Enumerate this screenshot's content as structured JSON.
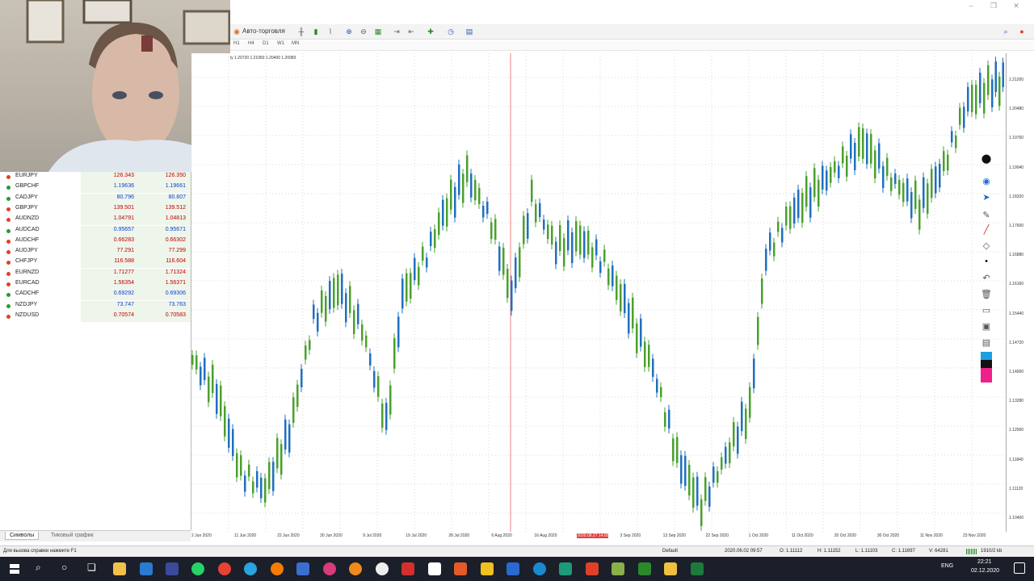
{
  "toolbar": {
    "autotrade_label": "Авто-торговля",
    "timeframes": [
      "H1",
      "H4",
      "D1",
      "W1",
      "MN"
    ]
  },
  "chart": {
    "info_line": "ly  1.20720  1.21083  1.20400  1.20983",
    "price_labels": [
      "1.21200",
      "1.20480",
      "1.19760",
      "1.19040",
      "1.18320",
      "1.17600",
      "1.16880",
      "1.16160",
      "1.15440",
      "1.14720",
      "1.14000",
      "1.13280",
      "1.12560",
      "1.11840",
      "1.11120",
      "1.10400"
    ],
    "time_labels": [
      "2 Jun 2020",
      "11 Jun 2020",
      "22 Jun 2020",
      "30 Jun 2020",
      "9 Jul 2020",
      "19 Jul 2020",
      "28 Jul 2020",
      "6 Aug 2020",
      "16 Aug 2020",
      "2020.08.27 14:00",
      "3 Sep 2020",
      "13 Sep 2020",
      "22 Sep 2020",
      "1 Oct 2020",
      "11 Oct 2020",
      "20 Oct 2020",
      "30 Oct 2020",
      "11 Nov 2020",
      "23 Nov 2020"
    ]
  },
  "watchlist": {
    "rows": [
      {
        "symbol": "EURJPY",
        "bid": "126.343",
        "ask": "126.350",
        "color": "#c00000"
      },
      {
        "symbol": "GBPCHF",
        "bid": "1.19636",
        "ask": "1.19661",
        "color": "#1040d0"
      },
      {
        "symbol": "CADJPY",
        "bid": "80.796",
        "ask": "80.807",
        "color": "#1040d0"
      },
      {
        "symbol": "GBPJPY",
        "bid": "139.501",
        "ask": "139.512",
        "color": "#c00000"
      },
      {
        "symbol": "AUDNZD",
        "bid": "1.04791",
        "ask": "1.04813",
        "color": "#c00000"
      },
      {
        "symbol": "AUDCAD",
        "bid": "0.95657",
        "ask": "0.95671",
        "color": "#1040d0"
      },
      {
        "symbol": "AUDCHF",
        "bid": "0.66283",
        "ask": "0.66302",
        "color": "#c00000"
      },
      {
        "symbol": "AUDJPY",
        "bid": "77.291",
        "ask": "77.299",
        "color": "#c00000"
      },
      {
        "symbol": "CHFJPY",
        "bid": "116.588",
        "ask": "116.604",
        "color": "#c00000"
      },
      {
        "symbol": "EURNZD",
        "bid": "1.71277",
        "ask": "1.71324",
        "color": "#c00000"
      },
      {
        "symbol": "EURCAD",
        "bid": "1.56354",
        "ask": "1.56371",
        "color": "#c00000"
      },
      {
        "symbol": "CADCHF",
        "bid": "0.69292",
        "ask": "0.69306",
        "color": "#1040d0"
      },
      {
        "symbol": "NZDJPY",
        "bid": "73.747",
        "ask": "73.763",
        "color": "#1040d0"
      },
      {
        "symbol": "NZDUSD",
        "bid": "0.70574",
        "ask": "0.70583",
        "color": "#c00000"
      }
    ],
    "tabs": [
      "Символы",
      "Тиковый график"
    ]
  },
  "statusbar": {
    "help": "Для вызова справки нажмите F1",
    "profile": "Default",
    "datetime": "2020.06.02 09:57",
    "open": "O: 1.11112",
    "high": "H: 1.11152",
    "low": "L: 1.11103",
    "close": "C: 1.11697",
    "volume": "V: 64281",
    "traffic": "1910/2 kb"
  },
  "taskbar": {
    "lang": "ENG",
    "time": "22:21",
    "date": "02.12.2020"
  },
  "colors": {
    "bull": "#4aa02c",
    "bear": "#1f6fbf",
    "bid_up": "#1040d0",
    "bid_down": "#c00000"
  }
}
